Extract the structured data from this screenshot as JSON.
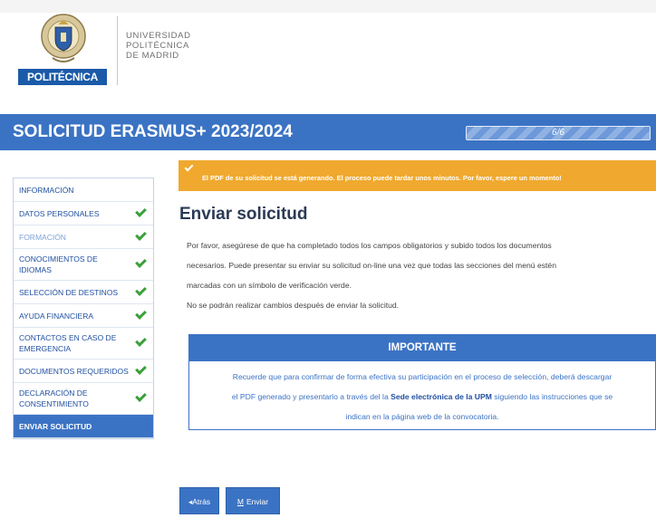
{
  "header": {
    "logo_badge": "POLITÉCNICA",
    "university_lines": [
      "UNIVERSIDAD",
      "POLITÉCNICA",
      "DE MADRID"
    ]
  },
  "band": {
    "title": "SOLICITUD ERASMUS+ 2023/2024",
    "progress_label": "6/6",
    "progress_fraction": 1.0
  },
  "sidebar": {
    "items": [
      {
        "label": "INFORMACIÓN",
        "checked": false,
        "state": "normal"
      },
      {
        "label": "DATOS PERSONALES",
        "checked": true,
        "state": "normal"
      },
      {
        "label": "FORMACIÓN",
        "checked": true,
        "state": "muted"
      },
      {
        "label": "CONOCIMIENTOS DE IDIOMAS",
        "checked": true,
        "state": "normal"
      },
      {
        "label": "SELECCIÓN DE DESTINOS",
        "checked": true,
        "state": "normal"
      },
      {
        "label": "AYUDA FINANCIERA",
        "checked": true,
        "state": "normal"
      },
      {
        "label": "CONTACTOS EN CASO DE EMERGENCIA",
        "checked": true,
        "state": "normal"
      },
      {
        "label": "DOCUMENTOS REQUERIDOS",
        "checked": true,
        "state": "normal"
      },
      {
        "label": "DECLARACIÓN DE CONSENTIMIENTO",
        "checked": true,
        "state": "normal"
      },
      {
        "label": "ENVIAR SOLICITUD",
        "checked": false,
        "state": "active"
      }
    ]
  },
  "alert": {
    "text": "El PDF de su solicitud se está generando. El proceso puede tardar unos minutos. Por favor, espere un momento!"
  },
  "main": {
    "title": "Enviar solicitud",
    "paragraph_lines": [
      "Por favor, asegúrese de que ha completado todos los campos obligatorios y subido todos los documentos",
      "necesarios. Puede presentar su enviar su solicitud on-line una vez que todas las secciones del menú estén",
      "marcadas con un símbolo de verificación verde.",
      "No se podrán realizar cambios después de enviar la solicitud."
    ]
  },
  "important": {
    "heading": "IMPORTANTE",
    "line1": "Recuerde que para confirmar de forma efectiva su participación en el proceso de selección, deberá descargar",
    "line2_before": "el PDF generado y presentarlo a través del la ",
    "line2_bold": "Sede electrónica de la UPM",
    "line2_after": " siguiendo las instrucciones que se",
    "line3": "indican en la página web de la convocatoria."
  },
  "buttons": {
    "back_label": "◂Atrás",
    "send_icon": "M",
    "send_label": "Enviar"
  },
  "colors": {
    "brand_blue": "#3b73c4",
    "alert_orange": "#f0a92e",
    "check_green": "#3aa03a"
  }
}
